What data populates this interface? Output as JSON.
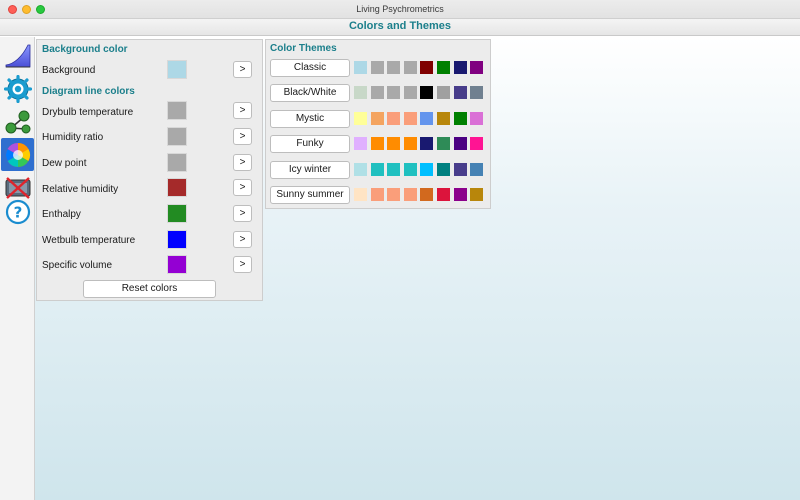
{
  "window": {
    "title": "Living Psychrometrics"
  },
  "header": {
    "title": "Colors and Themes"
  },
  "sidebar": {
    "items": [
      {
        "name": "chart-icon"
      },
      {
        "name": "settings-gear-icon"
      },
      {
        "name": "process-flow-icon"
      },
      {
        "name": "color-wheel-icon",
        "active": true
      },
      {
        "name": "delete-process-icon"
      },
      {
        "name": "help-icon"
      }
    ]
  },
  "background_section": {
    "title": "Background color",
    "rows": [
      {
        "label": "Background",
        "color": "#add8e6",
        "button": ">"
      }
    ]
  },
  "diagram_section": {
    "title": "Diagram line colors",
    "rows": [
      {
        "label": "Drybulb temperature",
        "color": "#a9a9a9",
        "button": ">"
      },
      {
        "label": "Humidity ratio",
        "color": "#a9a9a9",
        "button": ">"
      },
      {
        "label": "Dew point",
        "color": "#a9a9a9",
        "button": ">"
      },
      {
        "label": "Relative humidity",
        "color": "#a52a2a",
        "button": ">"
      },
      {
        "label": "Enthalpy",
        "color": "#228b22",
        "button": ">"
      },
      {
        "label": "Wetbulb temperature",
        "color": "#0000ff",
        "button": ">"
      },
      {
        "label": "Specific volume",
        "color": "#9400d3",
        "button": ">"
      }
    ],
    "reset_label": "Reset colors"
  },
  "themes": {
    "title": "Color Themes",
    "items": [
      {
        "label": "Classic",
        "colors": [
          "#add8e6",
          "#a9a9a9",
          "#a9a9a9",
          "#a9a9a9",
          "#800000",
          "#008000",
          "#191970",
          "#800080"
        ]
      },
      {
        "label": "Black/White",
        "colors": [
          "#c8d8c8",
          "#a9a9a9",
          "#a9a9a9",
          "#a9a9a9",
          "#000000",
          "#a0a0a0",
          "#483d8b",
          "#708090"
        ]
      },
      {
        "label": "Mystic",
        "colors": [
          "#ffff99",
          "#f4a460",
          "#fa9e7a",
          "#fa9e7a",
          "#6495ed",
          "#b8860b",
          "#008000",
          "#da70d6"
        ]
      },
      {
        "label": "Funky",
        "colors": [
          "#e0b0ff",
          "#ff8c00",
          "#ff8c00",
          "#ff8c00",
          "#191970",
          "#2e8b57",
          "#4b0082",
          "#ff1493"
        ]
      },
      {
        "label": "Icy winter",
        "colors": [
          "#b0e0e6",
          "#20c0c0",
          "#20c0c0",
          "#20c0c0",
          "#00bfff",
          "#008080",
          "#483d8b",
          "#4682b4"
        ]
      },
      {
        "label": "Sunny summer",
        "colors": [
          "#ffe4c4",
          "#fa9e7a",
          "#fa9e7a",
          "#fa9e7a",
          "#d2691e",
          "#dc143c",
          "#8b008b",
          "#b8860b"
        ]
      }
    ]
  }
}
